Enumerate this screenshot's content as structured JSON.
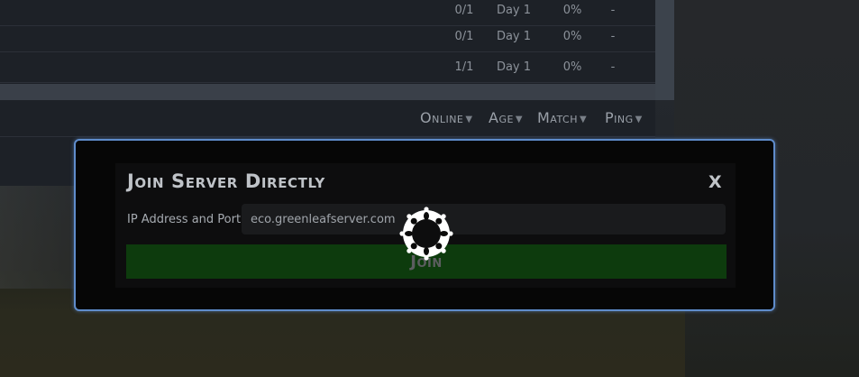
{
  "server_list": {
    "rows": [
      {
        "online": "0/1",
        "age": "Day 1",
        "match": "0%",
        "ping": "-"
      },
      {
        "online": "0/1",
        "age": "Day 1",
        "match": "0%",
        "ping": "-"
      },
      {
        "online": "1/1",
        "age": "Day 1",
        "match": "0%",
        "ping": "-"
      }
    ]
  },
  "columns": {
    "online": "Online",
    "age": "Age",
    "match": "Match",
    "ping": "Ping"
  },
  "dialog": {
    "title": "Join Server Directly",
    "close_label": "X",
    "ip_label": "IP Address and Port",
    "ip_value": "eco.greenleafserver.com",
    "join_label": "Join"
  },
  "colors": {
    "dialog_border": "#5f8ccb",
    "join_bg": "#0d3b0d"
  },
  "icons": {
    "spinner": "loading-spinner-icon",
    "sort": "chevron-down-icon"
  }
}
